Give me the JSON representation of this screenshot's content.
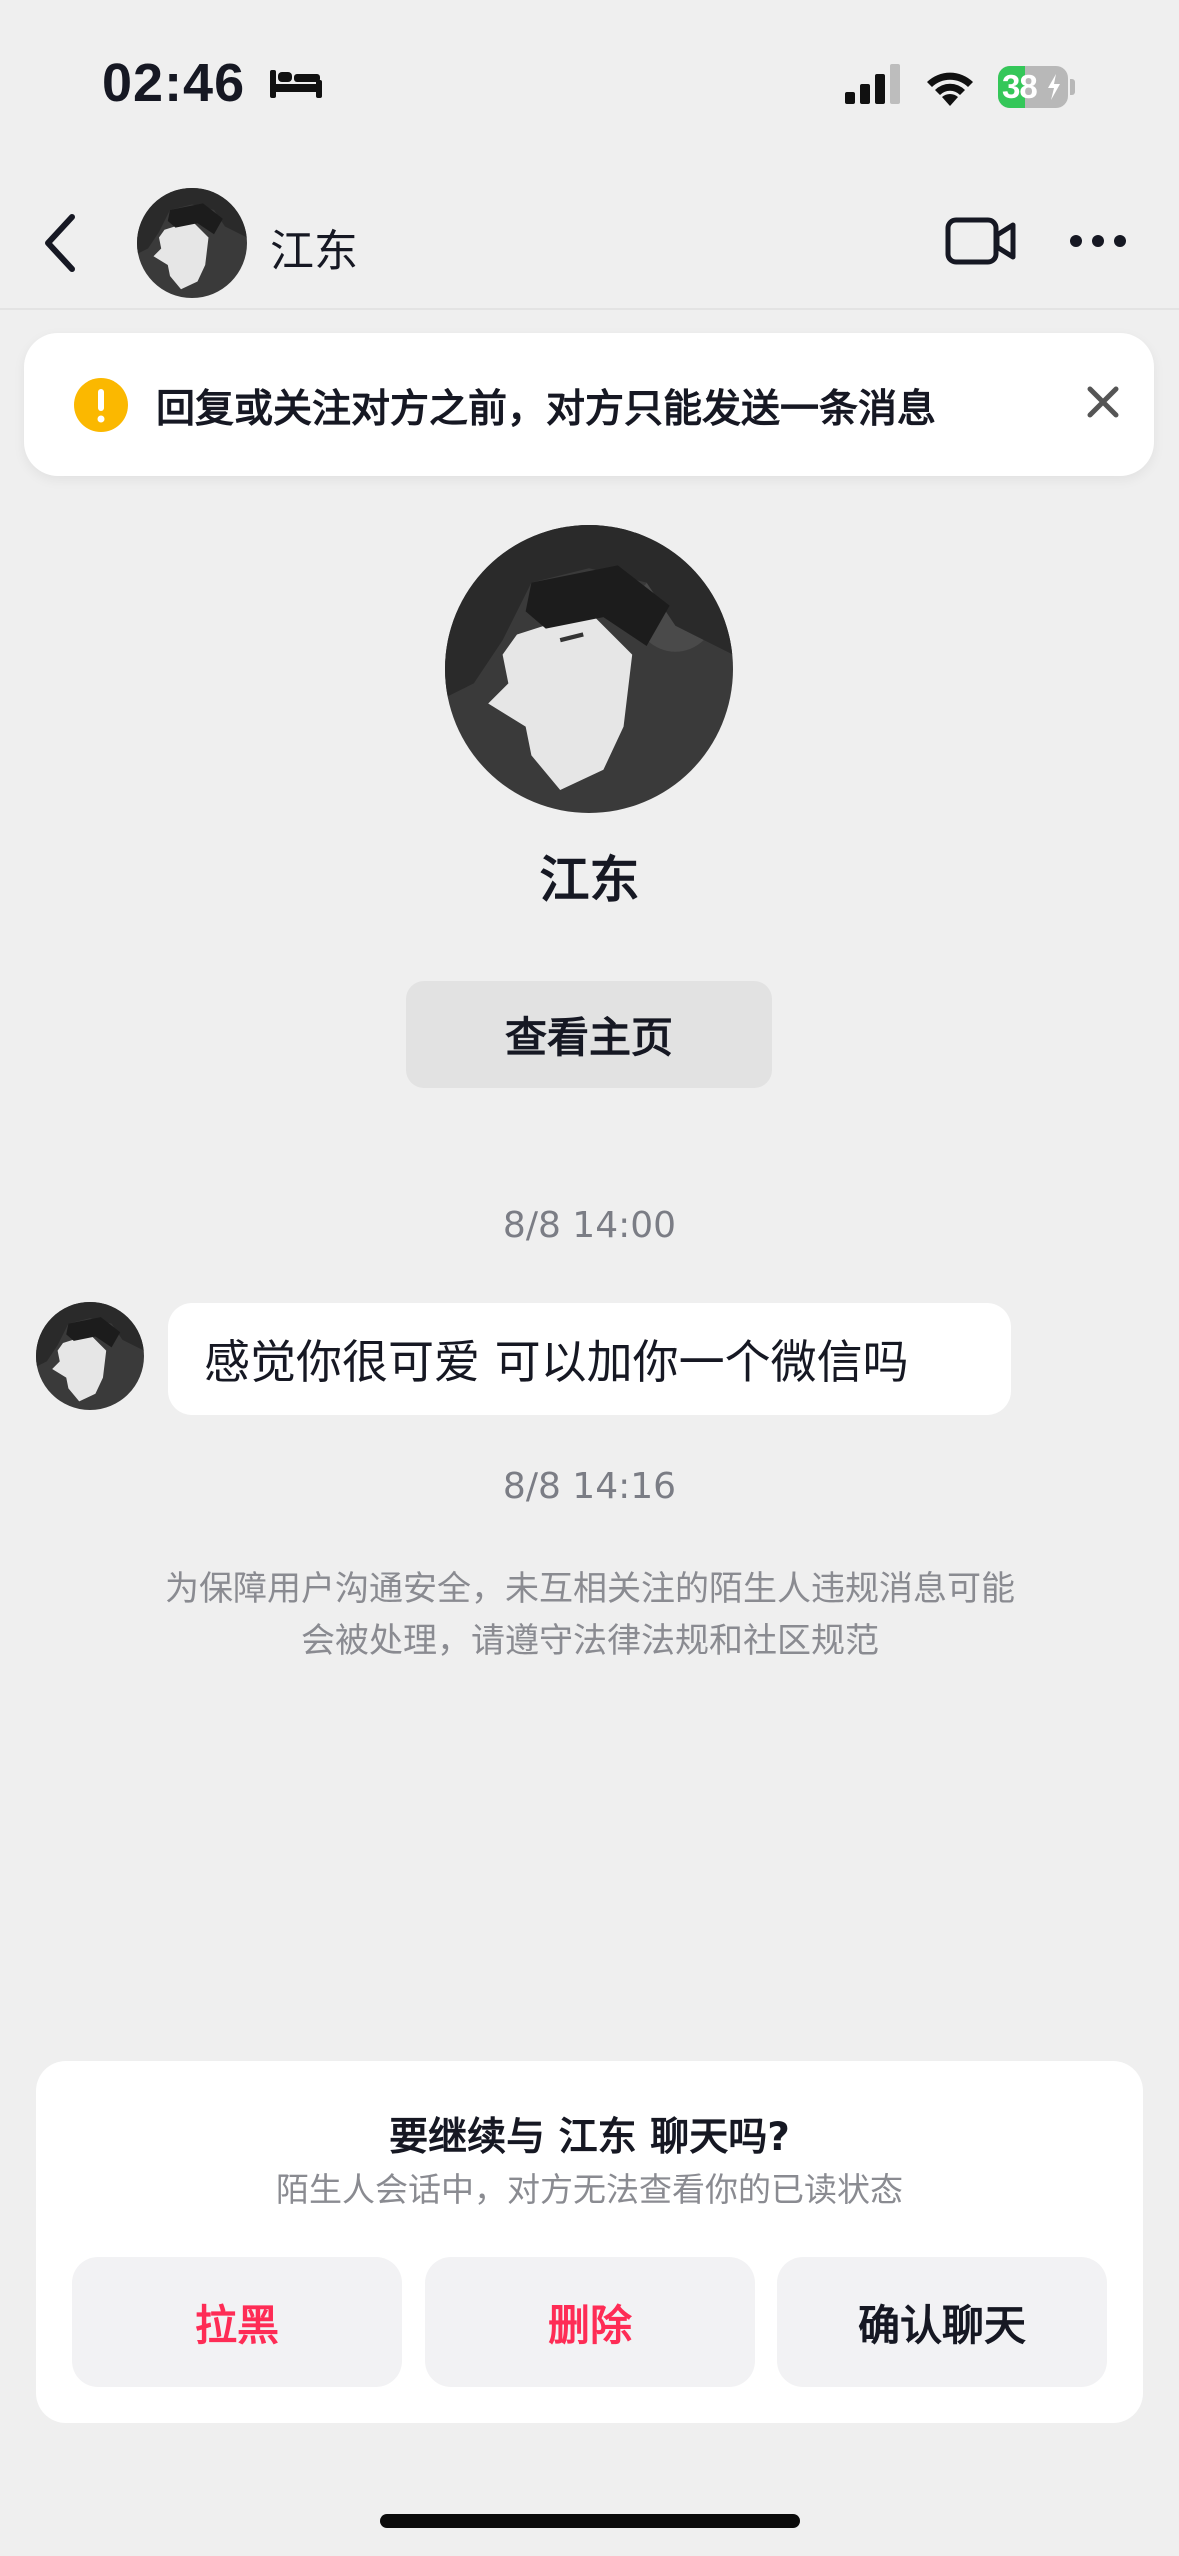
{
  "status_bar": {
    "time": "02:46",
    "battery": "38",
    "battery_level": 0.38,
    "icons": [
      "bed-icon",
      "signal-icon",
      "wifi-icon",
      "battery-charging-icon"
    ]
  },
  "nav": {
    "name": "江东",
    "icons": [
      "back-icon",
      "video-call-icon",
      "more-icon"
    ]
  },
  "banner": {
    "text": "回复或关注对方之前，对方只能发送一条消息",
    "icons": [
      "warning-icon",
      "close-icon"
    ]
  },
  "profile": {
    "name": "江东",
    "view_home_label": "查看主页"
  },
  "chat": {
    "timestamp_1": "8/8 14:00",
    "message_1": "感觉你很可爱 可以加你一个微信吗",
    "timestamp_2": "8/8 14:16",
    "notice": "为保障用户沟通安全，未互相关注的陌生人违规消息可能会被处理，请遵守法律法规和社区规范"
  },
  "sheet": {
    "title": "要继续与 江东 聊天吗?",
    "subtitle": "陌生人会话中，对方无法查看你的已读状态",
    "buttons": {
      "block": "拉黑",
      "delete": "删除",
      "confirm": "确认聊天"
    }
  },
  "colors": {
    "background": "#efefef",
    "danger": "#fe2c55",
    "warning": "#fbb800",
    "battery_green": "#34c759",
    "text_primary": "#161823",
    "text_secondary": "#8a8b91"
  }
}
